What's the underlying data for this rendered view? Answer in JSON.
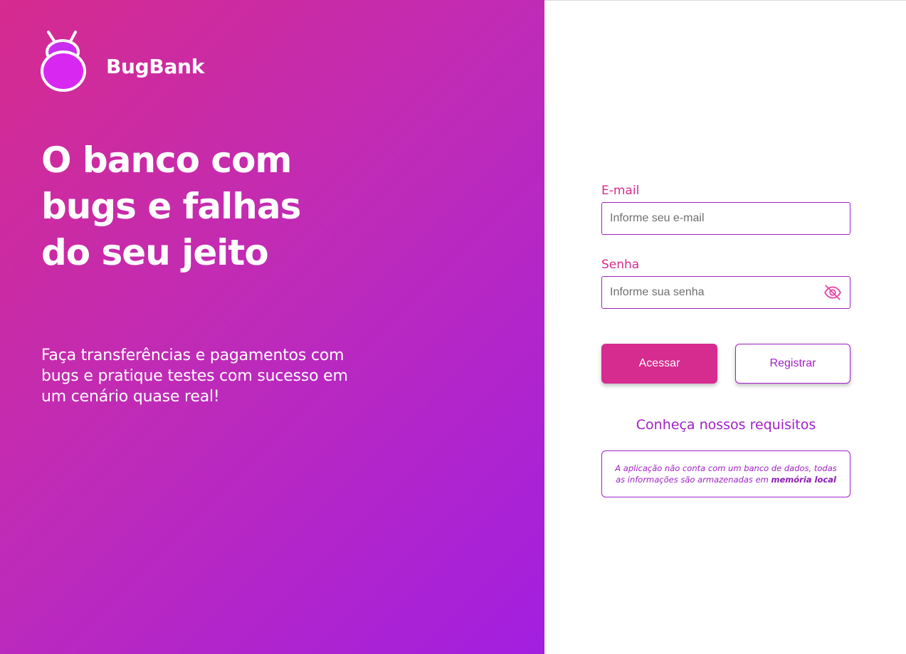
{
  "brand": {
    "name": "BugBank"
  },
  "hero": {
    "headline_lines": [
      "O banco com",
      "bugs e falhas",
      "do seu jeito"
    ],
    "subtext": "Faça transferências e pagamentos com bugs e pratique testes com sucesso em um cenário quase real!"
  },
  "form": {
    "email": {
      "label": "E-mail",
      "placeholder": "Informe seu e-mail",
      "value": ""
    },
    "password": {
      "label": "Senha",
      "placeholder": "Informe sua senha",
      "value": "",
      "toggle_icon": "eye-off-icon"
    },
    "login_label": "Acessar",
    "register_label": "Registrar"
  },
  "requirements_link": "Conheça nossos requisitos",
  "notice": {
    "text": "A aplicação não conta com um banco de dados, todas as informações são armazenadas em",
    "emphasis": "memória local"
  },
  "colors": {
    "gradient_start": "#d62b8f",
    "gradient_end": "#a21fe0",
    "primary": "#d62b8f",
    "secondary": "#a21fc6"
  }
}
